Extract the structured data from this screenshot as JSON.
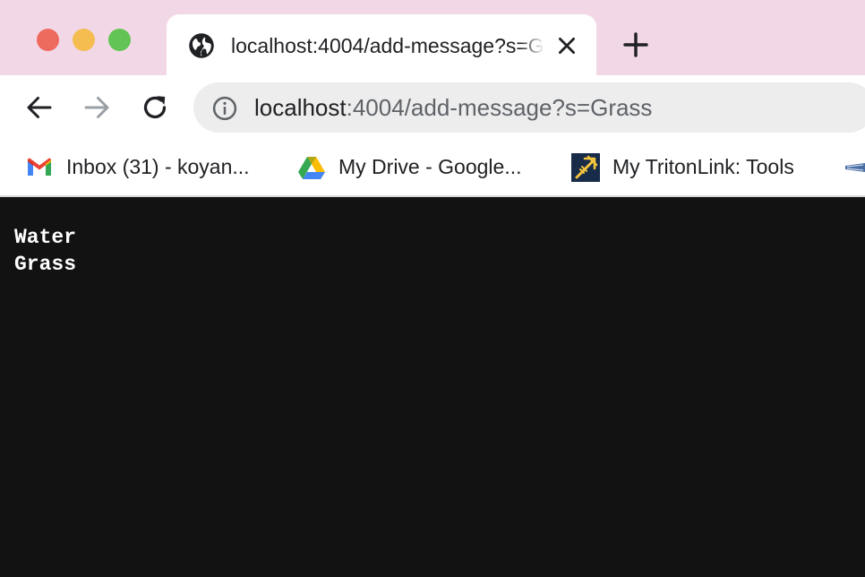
{
  "tab": {
    "title": "localhost:4004/add-message?s=Grass",
    "icon": "globe-icon"
  },
  "toolbar": {
    "url_host": "localhost",
    "url_rest": ":4004/add-message?s=Grass"
  },
  "bookmarks": [
    {
      "label": "Inbox (31) - koyan...",
      "icon": "gmail-icon"
    },
    {
      "label": "My Drive - Google...",
      "icon": "google-drive-icon"
    },
    {
      "label": "My TritonLink: Tools",
      "icon": "tritonlink-icon"
    },
    {
      "label": "",
      "icon": "bookmark-favicon-icon"
    }
  ],
  "page": {
    "messages": [
      "Water",
      "Grass"
    ]
  },
  "colors": {
    "tab_strip": "#f2d8e6",
    "page_background": "#121212",
    "page_text": "#ffffff",
    "omnibox": "#ededed"
  }
}
